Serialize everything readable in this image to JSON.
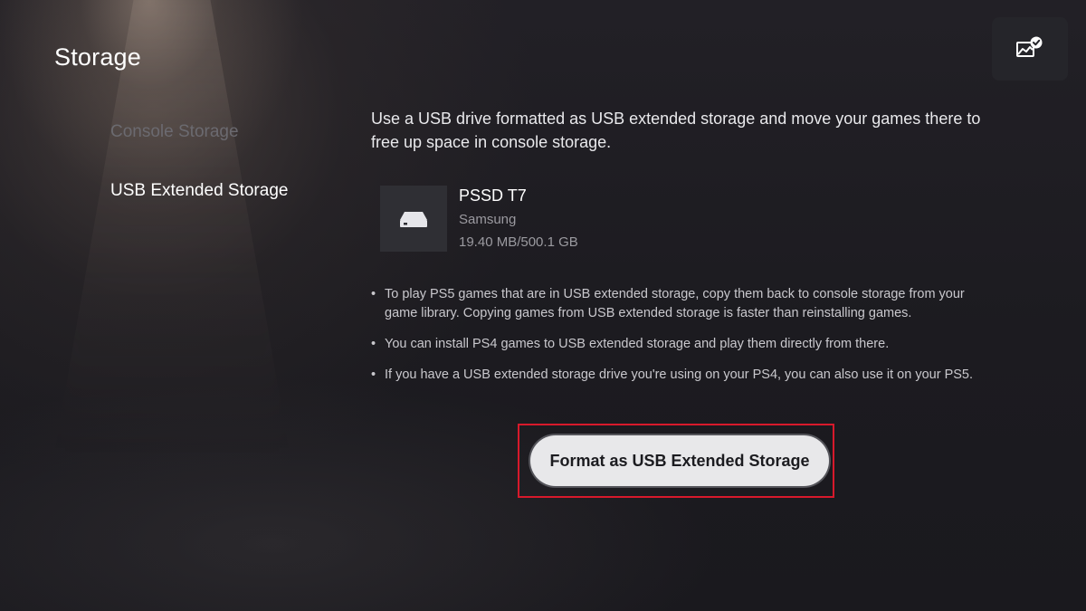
{
  "header": {
    "title": "Storage"
  },
  "top_right": {
    "icon": "gallery-check-icon"
  },
  "sidebar": {
    "items": [
      {
        "label": "Console Storage",
        "state": "dimmed"
      },
      {
        "label": "USB Extended Storage",
        "state": "selected"
      }
    ]
  },
  "main": {
    "intro": "Use a USB drive formatted as USB extended storage and move your games there to free up space in console storage.",
    "drive": {
      "icon": "external-drive-icon",
      "name": "PSSD T7",
      "manufacturer": "Samsung",
      "usage": "19.40 MB/500.1 GB"
    },
    "notes": [
      "To play PS5 games that are in USB extended storage, copy them back to console storage from your game library. Copying games from USB extended storage is faster than reinstalling games.",
      "You can install PS4 games to USB extended storage and play them directly from there.",
      "If you have a USB extended storage drive you're using on your PS4, you can also use it on your PS5."
    ],
    "format_button": {
      "label": "Format as USB Extended Storage",
      "highlight_color": "#d7192b"
    }
  },
  "colors": {
    "background": "#1b1a1e",
    "text_primary": "#ffffff",
    "text_dim": "#6b6a70",
    "button_face": "#e8e8ea"
  }
}
